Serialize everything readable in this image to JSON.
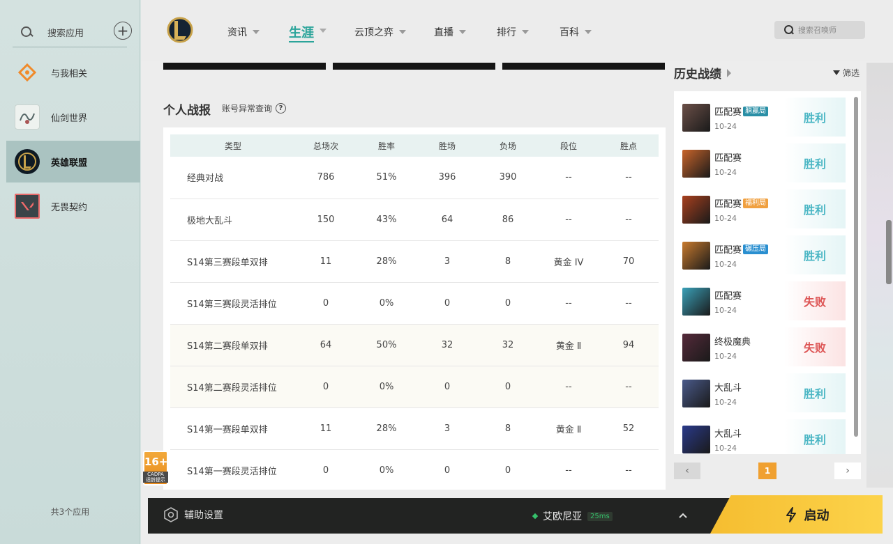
{
  "sidebar": {
    "search_label": "搜索应用",
    "apps": [
      {
        "label": "与我相关",
        "icon": "related-icon"
      },
      {
        "label": "仙剑世界",
        "icon": "xianjian-world-icon"
      },
      {
        "label": "英雄联盟",
        "icon": "league-of-legends-icon"
      },
      {
        "label": "无畏契约",
        "icon": "valorant-icon"
      }
    ],
    "active_app": "英雄联盟",
    "app_count": "共3个应用"
  },
  "age_rating": {
    "value": "16+",
    "org": "CADPA",
    "label": "适龄提示"
  },
  "nav": {
    "items": [
      {
        "label": "资讯"
      },
      {
        "label": "生涯"
      },
      {
        "label": "云顶之弈"
      },
      {
        "label": "直播"
      },
      {
        "label": "排行"
      },
      {
        "label": "百科"
      }
    ],
    "active": "生涯",
    "search_placeholder": "搜索召唤师"
  },
  "stats": {
    "title": "个人战报",
    "anomaly_link": "账号异常查询",
    "columns": [
      "类型",
      "总场次",
      "胜率",
      "胜场",
      "负场",
      "段位",
      "胜点"
    ],
    "rows": [
      [
        "经典对战",
        "786",
        "51%",
        "396",
        "390",
        "--",
        "--"
      ],
      [
        "极地大乱斗",
        "150",
        "43%",
        "64",
        "86",
        "--",
        "--"
      ],
      [
        "S14第三赛段单双排",
        "11",
        "28%",
        "3",
        "8",
        "黄金 IV",
        "70"
      ],
      [
        "S14第三赛段灵活排位",
        "0",
        "0%",
        "0",
        "0",
        "--",
        "--"
      ],
      [
        "S14第二赛段单双排",
        "64",
        "50%",
        "32",
        "32",
        "黄金 Ⅱ",
        "94"
      ],
      [
        "S14第二赛段灵活排位",
        "0",
        "0%",
        "0",
        "0",
        "--",
        "--"
      ],
      [
        "S14第一赛段单双排",
        "11",
        "28%",
        "3",
        "8",
        "黄金 Ⅱ",
        "52"
      ],
      [
        "S14第一赛段灵活排位",
        "0",
        "0%",
        "0",
        "0",
        "--",
        "--"
      ]
    ]
  },
  "history": {
    "title": "历史战绩",
    "filter_label": "筛选",
    "matches": [
      {
        "mode": "匹配赛",
        "tag": "躺赢局",
        "tag_color": "#2a8fa6",
        "date": "10-24",
        "result": "胜利",
        "win": true,
        "champ_color": "#6b5048"
      },
      {
        "mode": "匹配赛",
        "tag": "",
        "tag_color": "",
        "date": "10-24",
        "result": "胜利",
        "win": true,
        "champ_color": "#c8642a"
      },
      {
        "mode": "匹配赛",
        "tag": "福利局",
        "tag_color": "#f0a040",
        "date": "10-24",
        "result": "胜利",
        "win": true,
        "champ_color": "#a8401e"
      },
      {
        "mode": "匹配赛",
        "tag": "碾压局",
        "tag_color": "#2a8fd0",
        "date": "10-24",
        "result": "胜利",
        "win": true,
        "champ_color": "#c87a2e"
      },
      {
        "mode": "匹配赛",
        "tag": "",
        "tag_color": "",
        "date": "10-24",
        "result": "失败",
        "win": false,
        "champ_color": "#3aa0b8"
      },
      {
        "mode": "终极魔典",
        "tag": "",
        "tag_color": "",
        "date": "10-24",
        "result": "失败",
        "win": false,
        "champ_color": "#552a3a"
      },
      {
        "mode": "大乱斗",
        "tag": "",
        "tag_color": "",
        "date": "10-24",
        "result": "胜利",
        "win": true,
        "champ_color": "#4a5a8a"
      },
      {
        "mode": "大乱斗",
        "tag": "",
        "tag_color": "",
        "date": "10-24",
        "result": "胜利",
        "win": true,
        "champ_color": "#2a3a8a"
      }
    ],
    "pager": {
      "prev": "‹",
      "current": "1",
      "next": "›"
    }
  },
  "bottom": {
    "assist_label": "辅助设置",
    "server_name": "艾欧尼亚",
    "ping": "25ms",
    "launch_label": "启动"
  }
}
